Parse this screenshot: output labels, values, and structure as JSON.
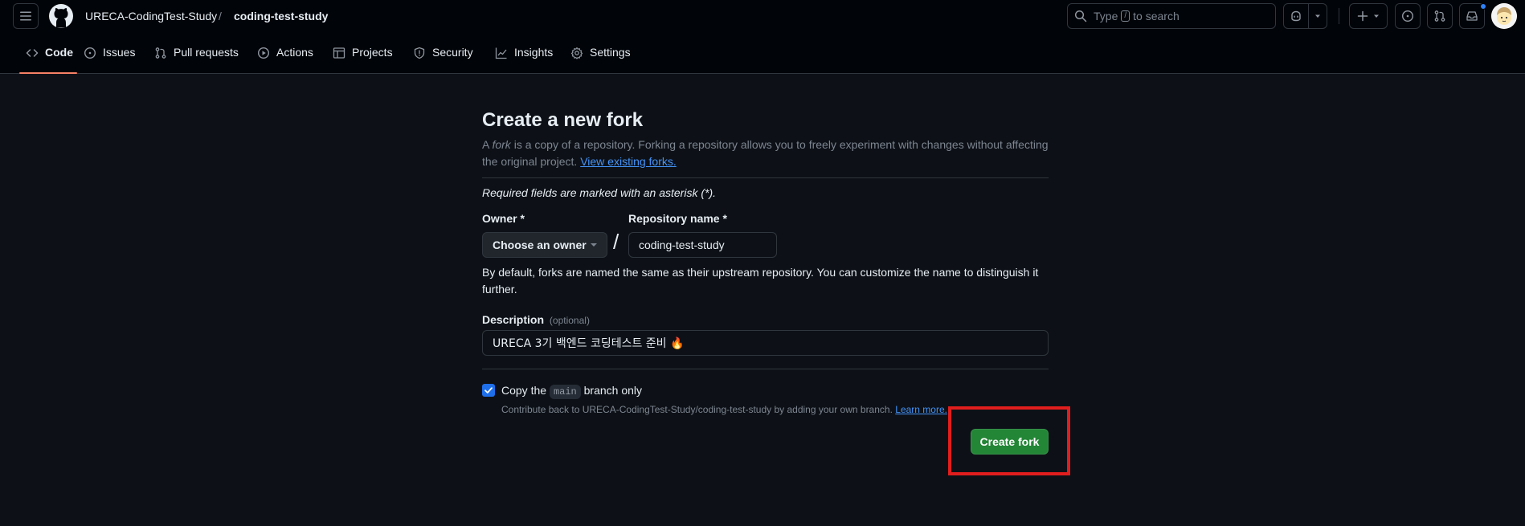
{
  "header": {
    "owner": "URECA-CodingTest-Study",
    "separator": "/",
    "repo": "coding-test-study",
    "search": {
      "prefix": "Type",
      "key": "/",
      "suffix": "to search"
    }
  },
  "tabs": [
    {
      "label": "Code",
      "icon": "code-icon",
      "active": true
    },
    {
      "label": "Issues",
      "icon": "issue-opened-icon"
    },
    {
      "label": "Pull requests",
      "icon": "git-pull-request-icon"
    },
    {
      "label": "Actions",
      "icon": "play-icon"
    },
    {
      "label": "Projects",
      "icon": "table-icon"
    },
    {
      "label": "Security",
      "icon": "shield-icon"
    },
    {
      "label": "Insights",
      "icon": "graph-icon"
    },
    {
      "label": "Settings",
      "icon": "gear-icon"
    }
  ],
  "form": {
    "title": "Create a new fork",
    "intro_a": "A",
    "intro_fork": "fork",
    "intro_b": "is a copy of a repository. Forking a repository allows you to freely experiment with changes without affecting the original project.",
    "intro_link": "View existing forks.",
    "required_note": "Required fields are marked with an asterisk (*).",
    "owner_label": "Owner *",
    "owner_button": "Choose an owner",
    "slash": "/",
    "repo_label": "Repository name *",
    "repo_value": "coding-test-study",
    "repo_help": "By default, forks are named the same as their upstream repository. You can customize the name to distinguish it further.",
    "desc_label": "Description",
    "desc_optional": "(optional)",
    "desc_value": "URECA 3기 백엔드 코딩테스트 준비 🔥",
    "copy_a": "Copy the",
    "copy_branch": "main",
    "copy_b": "branch only",
    "copy_checked": true,
    "contribute_text": "Contribute back to URECA-CodingTest-Study/coding-test-study by adding your own branch.",
    "contribute_link": "Learn more.",
    "submit": "Create fork"
  },
  "colors": {
    "background": "#0d1117",
    "header_bg": "#010409",
    "accent_link": "#4493f8",
    "primary_button": "#238636",
    "tab_underline": "#f78166",
    "highlight_box": "#e11d1d"
  }
}
